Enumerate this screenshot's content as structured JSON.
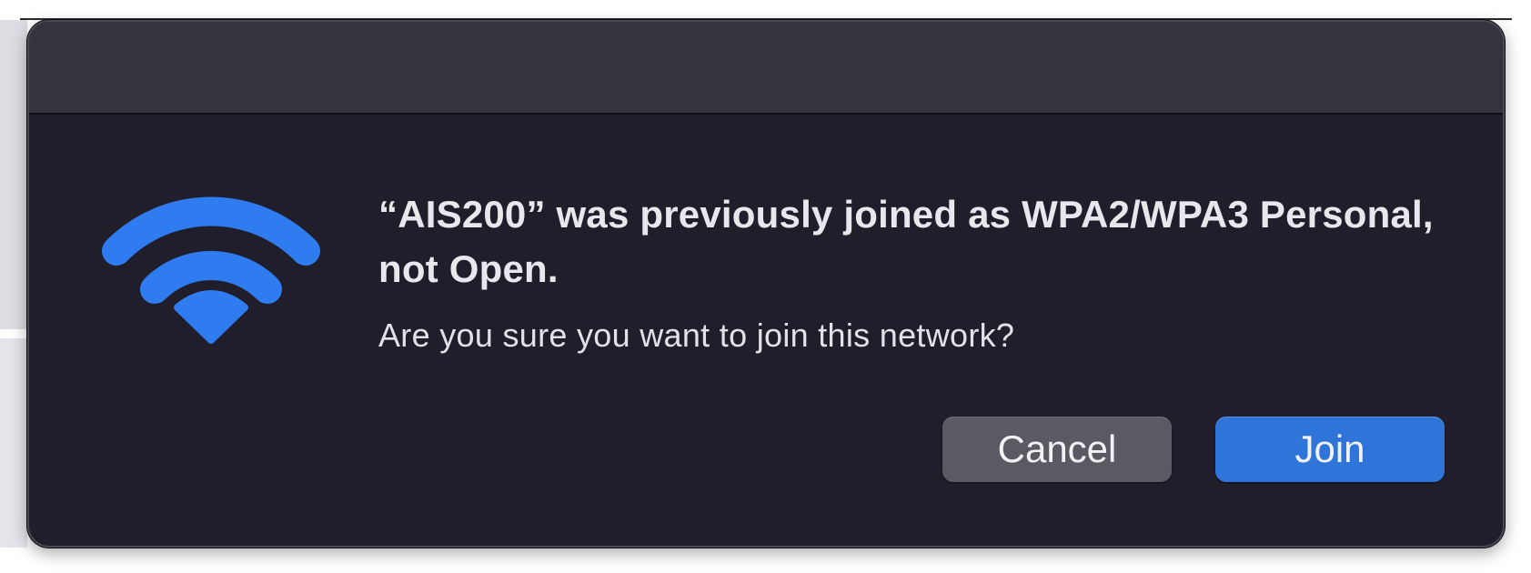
{
  "dialog": {
    "headline": "“AIS200” was previously joined as WPA2/WPA3 Personal, not Open.",
    "message": "Are you sure you want to join this network?",
    "icon": "wifi-icon",
    "icon_color": "#2f7bf0"
  },
  "buttons": {
    "cancel_label": "Cancel",
    "join_label": "Join",
    "join_color": "#2f74d8",
    "cancel_color": "#5b5962"
  },
  "colors": {
    "dialog_background": "#211e2b",
    "titlebar_background": "#36333e",
    "text": "#e8e7ec"
  }
}
